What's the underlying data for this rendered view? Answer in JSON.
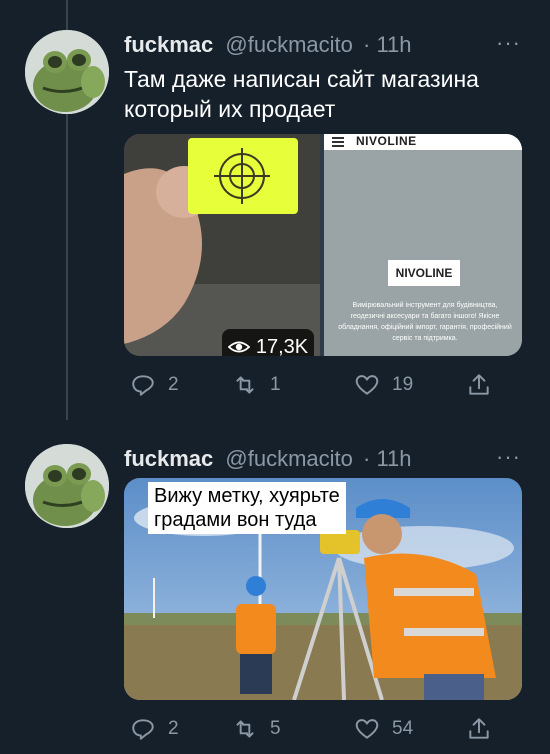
{
  "tweets": [
    {
      "author": "fuckmac",
      "handle": "@fuckmacito",
      "time": "· 11h",
      "more": "···",
      "text_line1": "Там даже написан сайт магазина",
      "text_line2": "который их продает",
      "media": {
        "views_count": "17,3K",
        "site_header": "NIVOLINE",
        "site_logo": "NIVOLINE",
        "site_text": "Вимірювальний інструмент для будівництва, геодезичні аксесуари та багато іншого! Якісне обладнання, офіційний імпорт, гарантія, професійний сервіс та підтримка."
      },
      "actions": {
        "replies": "2",
        "retweets": "1",
        "likes": "19"
      }
    },
    {
      "author": "fuckmac",
      "handle": "@fuckmacito",
      "time": "· 11h",
      "more": "···",
      "media": {
        "caption_line1": "Вижу метку, хуярьте",
        "caption_line2": "градами вон туда"
      },
      "actions": {
        "replies": "2",
        "retweets": "5",
        "likes": "54"
      }
    }
  ],
  "colors": {
    "background": "#15202b",
    "secondary_text": "#8b98a5",
    "accent_yellow": "#e6ff3a",
    "vest_orange": "#f28a1e",
    "hardhat_blue": "#2f7fd6"
  },
  "icons": [
    "reply-icon",
    "retweet-icon",
    "like-icon",
    "share-icon",
    "eye-icon",
    "menu-icon"
  ]
}
